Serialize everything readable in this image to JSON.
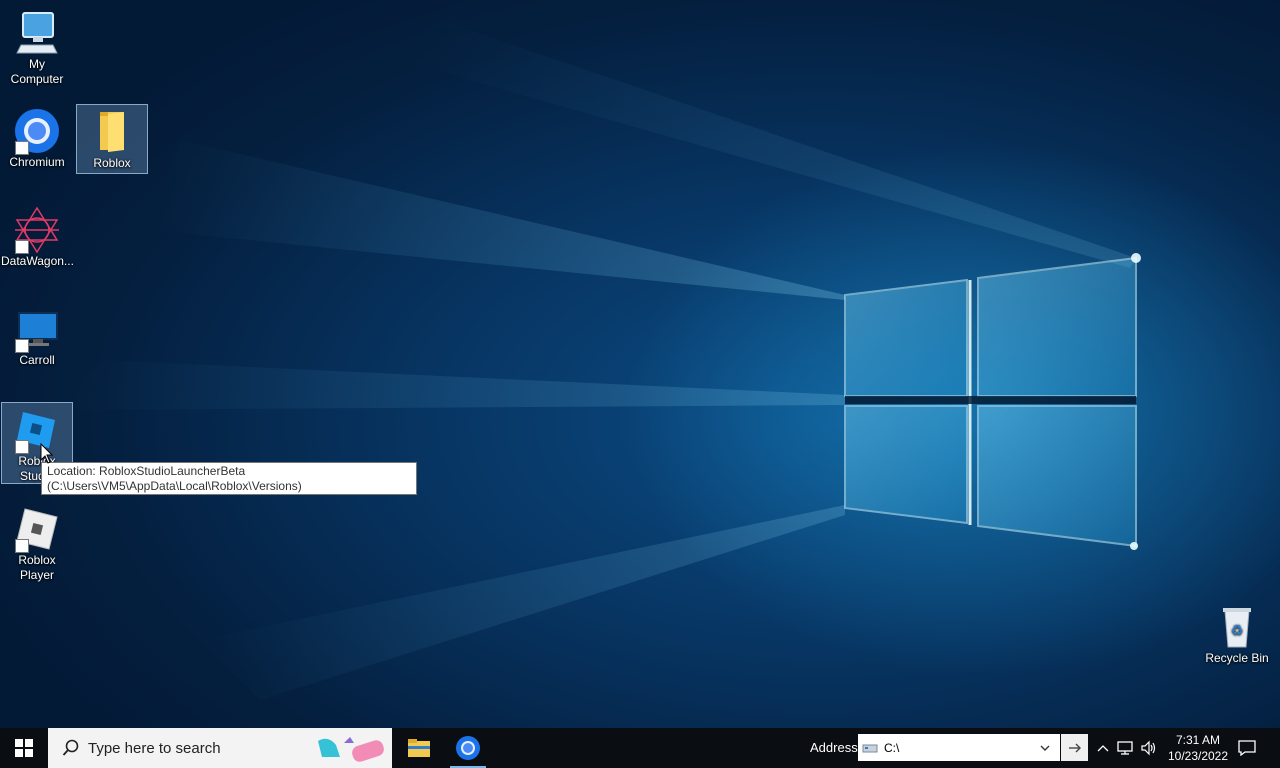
{
  "desktop": {
    "icons": [
      {
        "label": "My\nComputer",
        "icon": "computer-icon"
      },
      {
        "label": "Chromium",
        "icon": "chromium-icon"
      },
      {
        "label": "Roblox",
        "icon": "folder-icon"
      },
      {
        "label": "DataWagon...",
        "icon": "datawagon-icon"
      },
      {
        "label": "Carroll",
        "icon": "monitor-icon"
      },
      {
        "label": "Roblox\nStudio",
        "icon": "roblox-studio-icon"
      },
      {
        "label": "Roblox\nPlayer",
        "icon": "roblox-player-icon"
      },
      {
        "label": "Recycle Bin",
        "icon": "recycle-bin-icon"
      }
    ],
    "tooltip": "Location: RobloxStudioLauncherBeta (C:\\Users\\VM5\\AppData\\Local\\Roblox\\Versions)"
  },
  "taskbar": {
    "search_placeholder": "Type here to search",
    "address_label": "Address",
    "address_value": "C:\\",
    "time": "7:31 AM",
    "date": "10/23/2022"
  },
  "colors": {
    "accent": "#76b9ed",
    "taskbar_bg": "#0a0d12"
  }
}
